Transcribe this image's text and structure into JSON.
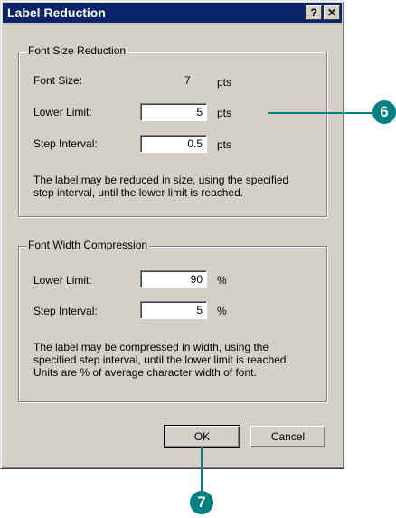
{
  "dialog": {
    "title": "Label Reduction",
    "help_button": "?",
    "close_button": "✕"
  },
  "font_size_group": {
    "legend": "Font Size Reduction",
    "font_size_label": "Font Size:",
    "font_size_value": "7",
    "font_size_unit": "pts",
    "lower_limit_label": "Lower Limit:",
    "lower_limit_value": "5",
    "lower_limit_unit": "pts",
    "step_interval_label": "Step Interval:",
    "step_interval_value": "0.5",
    "step_interval_unit": "pts",
    "description_line1": "The label may be reduced in size, using the specified",
    "description_line2": "step interval, until the lower limit is reached."
  },
  "font_width_group": {
    "legend": "Font Width Compression",
    "lower_limit_label": "Lower Limit:",
    "lower_limit_value": "90",
    "lower_limit_unit": "%",
    "step_interval_label": "Step Interval:",
    "step_interval_value": "5",
    "step_interval_unit": "%",
    "description_line1": "The label may be compressed in width, using the",
    "description_line2": "specified step interval, until the lower limit is reached.",
    "description_line3": "Units are % of average character width of font."
  },
  "buttons": {
    "ok": "OK",
    "cancel": "Cancel"
  },
  "callouts": {
    "lower_limit_callout": "6",
    "ok_callout": "7"
  },
  "colors": {
    "titlebar": "#0a246a",
    "dialog_face": "#d4d0c8",
    "callout": "#008080"
  }
}
